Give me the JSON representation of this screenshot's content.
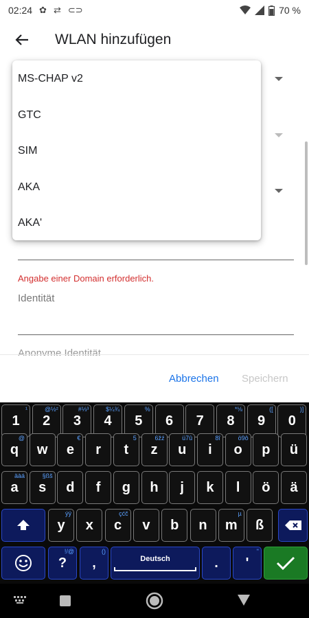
{
  "status_bar": {
    "time": "02:24",
    "battery": "70 %"
  },
  "app_bar": {
    "title": "WLAN hinzufügen"
  },
  "menu": {
    "items": [
      "MS-CHAP v2",
      "GTC",
      "SIM",
      "AKA",
      "AKA'"
    ]
  },
  "form": {
    "error": "Angabe einer Domain erforderlich.",
    "identity_label": "Identität",
    "anon_label": "Anonyme Identität"
  },
  "buttons": {
    "cancel": "Abbrechen",
    "save": "Speichern"
  },
  "keyboard": {
    "language": "Deutsch",
    "row1": [
      {
        "k": "1",
        "h": "¹"
      },
      {
        "k": "2",
        "h": "@½²"
      },
      {
        "k": "3",
        "h": "#⅓³"
      },
      {
        "k": "4",
        "h": "$¼¾"
      },
      {
        "k": "5",
        "h": "%"
      },
      {
        "k": "6",
        "h": ""
      },
      {
        "k": "7",
        "h": ""
      },
      {
        "k": "8",
        "h": "*⅛"
      },
      {
        "k": "9",
        "h": "(["
      },
      {
        "k": "0",
        "h": ")]"
      }
    ],
    "row2": [
      {
        "k": "q",
        "h": "@"
      },
      {
        "k": "w",
        "h": ""
      },
      {
        "k": "e",
        "h": "€"
      },
      {
        "k": "r",
        "h": ""
      },
      {
        "k": "t",
        "h": "5"
      },
      {
        "k": "z",
        "h": "6žź"
      },
      {
        "k": "u",
        "h": "ü7û"
      },
      {
        "k": "i",
        "h": "8î"
      },
      {
        "k": "o",
        "h": "ö9ô"
      },
      {
        "k": "p",
        "h": ""
      },
      {
        "k": "ü",
        "h": ""
      }
    ],
    "row3": [
      {
        "k": "a",
        "h": "äàá"
      },
      {
        "k": "s",
        "h": "§ßš"
      },
      {
        "k": "d",
        "h": ""
      },
      {
        "k": "f",
        "h": ""
      },
      {
        "k": "g",
        "h": ""
      },
      {
        "k": "h",
        "h": ""
      },
      {
        "k": "j",
        "h": ""
      },
      {
        "k": "k",
        "h": ""
      },
      {
        "k": "l",
        "h": ""
      },
      {
        "k": "ö",
        "h": ""
      },
      {
        "k": "ä",
        "h": ""
      }
    ],
    "row4": [
      {
        "k": "y",
        "h": "ýÿ"
      },
      {
        "k": "x",
        "h": ""
      },
      {
        "k": "c",
        "h": "çćč"
      },
      {
        "k": "v",
        "h": ""
      },
      {
        "k": "b",
        "h": ""
      },
      {
        "k": "n",
        "h": ""
      },
      {
        "k": "m",
        "h": "µ"
      },
      {
        "k": "ß",
        "h": ""
      }
    ],
    "row5_labels": {
      "question": "?",
      "comma": ",",
      "period": ".",
      "apostrophe": "'"
    },
    "row5_hints": {
      "question": "!/@",
      "comma": "()",
      "period": "",
      "apostrophe": "\""
    }
  },
  "colors": {
    "accent": "#1a73e8",
    "error": "#d32f2f",
    "keyboard_blue": "#0d1a5c",
    "keyboard_green": "#1a7a24"
  }
}
